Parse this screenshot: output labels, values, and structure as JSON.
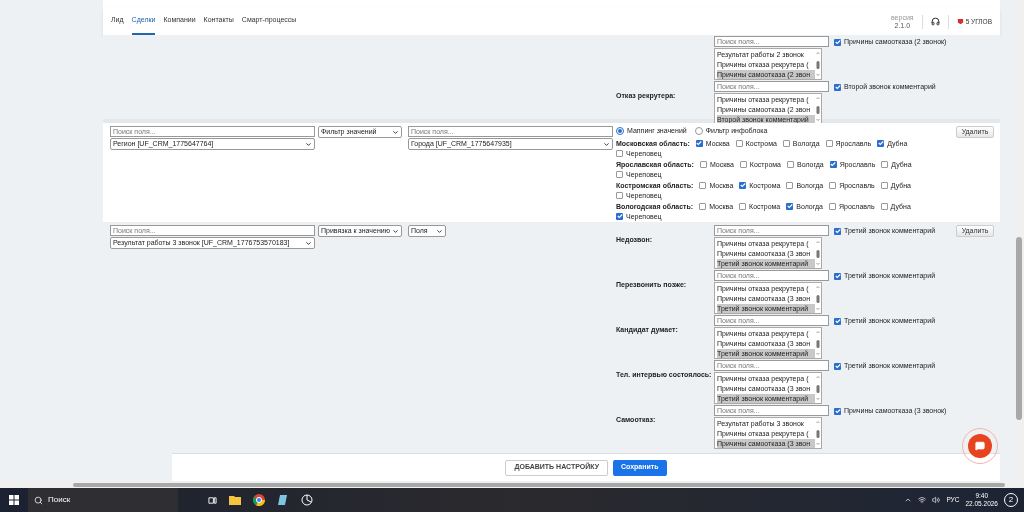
{
  "nav": {
    "tabs": [
      {
        "label": "Лид",
        "selected": false
      },
      {
        "label": "Сделки",
        "selected": true
      },
      {
        "label": "Компании",
        "selected": false
      },
      {
        "label": "Контакты",
        "selected": false
      },
      {
        "label": "Смарт-процессы",
        "selected": false
      }
    ],
    "version_label": "версия",
    "version": "2.1.0",
    "brand": "5 УГЛОВ"
  },
  "top_block": {
    "mappings": [
      {
        "search_placeholder": "Поиск поля...",
        "options": [
          {
            "label": "Результат работы 2 звонок",
            "selected": false
          },
          {
            "label": "Причины отказа рекрутера (",
            "selected": false
          },
          {
            "label": "Причины самоотказа (2 звон",
            "selected": true
          }
        ],
        "checked": true,
        "target": "Причины самоотказа (2 звонок)"
      },
      {
        "label": "Отказ рекрутера:",
        "search_placeholder": "Поиск поля...",
        "options": [
          {
            "label": "Причины отказа рекрутера (",
            "selected": false
          },
          {
            "label": "Причины самоотказа (2 звон",
            "selected": false
          },
          {
            "label": "Второй звонок комментарий",
            "selected": true
          }
        ],
        "checked": true,
        "target": "Второй звонок комментарий"
      }
    ]
  },
  "region_rule": {
    "source_placeholder": "Поиск поля...",
    "source_field": "Регион [UF_CRM_1775647764]",
    "mode": "Фильтр значений",
    "target_placeholder": "Поиск поля...",
    "target_field": "Города [UF_CRM_1775647935]",
    "radios": [
      {
        "label": "Маппинг значений",
        "selected": true
      },
      {
        "label": "Фильтр инфоблока",
        "selected": false
      }
    ],
    "regions": [
      {
        "label": "Московская область:",
        "options": [
          {
            "label": "Москва",
            "checked": true
          },
          {
            "label": "Кострома",
            "checked": false
          },
          {
            "label": "Вологда",
            "checked": false
          },
          {
            "label": "Ярославль",
            "checked": false
          },
          {
            "label": "Дубна",
            "checked": true
          },
          {
            "label": "Череповец",
            "checked": false
          }
        ]
      },
      {
        "label": "Ярославская область:",
        "options": [
          {
            "label": "Москва",
            "checked": false
          },
          {
            "label": "Кострома",
            "checked": false
          },
          {
            "label": "Вологда",
            "checked": false
          },
          {
            "label": "Ярославль",
            "checked": true
          },
          {
            "label": "Дубна",
            "checked": false
          },
          {
            "label": "Череповец",
            "checked": false
          }
        ]
      },
      {
        "label": "Костромская область:",
        "options": [
          {
            "label": "Москва",
            "checked": false
          },
          {
            "label": "Кострома",
            "checked": true
          },
          {
            "label": "Вологда",
            "checked": false
          },
          {
            "label": "Ярославль",
            "checked": false
          },
          {
            "label": "Дубна",
            "checked": false
          },
          {
            "label": "Череповец",
            "checked": false
          }
        ]
      },
      {
        "label": "Вологодская область:",
        "options": [
          {
            "label": "Москва",
            "checked": false
          },
          {
            "label": "Кострома",
            "checked": false
          },
          {
            "label": "Вологда",
            "checked": true
          },
          {
            "label": "Ярославль",
            "checked": false
          },
          {
            "label": "Дубна",
            "checked": false
          },
          {
            "label": "Череповец",
            "checked": true
          }
        ]
      }
    ],
    "delete": "Удалить"
  },
  "value_rule": {
    "source_placeholder": "Поиск поля...",
    "source_field": "Результат работы 3 звонок [UF_CRM_1776753570183]",
    "mode": "Привязка к значению",
    "target_field": "Поля",
    "delete": "Удалить",
    "mappings": [
      {
        "label": "Недозвон:",
        "search_placeholder": "Поиск поля...",
        "options": [
          {
            "label": "Причины отказа рекрутера (",
            "selected": false
          },
          {
            "label": "Причины самоотказа (3 звон",
            "selected": false
          },
          {
            "label": "Третий звонок комментарий",
            "selected": true
          }
        ],
        "checked": true,
        "target": "Третий звонок комментарий"
      },
      {
        "label": "Перезвонить позже:",
        "search_placeholder": "Поиск поля...",
        "options": [
          {
            "label": "Причины отказа рекрутера (",
            "selected": false
          },
          {
            "label": "Причины самоотказа (3 звон",
            "selected": false
          },
          {
            "label": "Третий звонок комментарий",
            "selected": true
          }
        ],
        "checked": true,
        "target": "Третий звонок комментарий"
      },
      {
        "label": "Кандидат думает:",
        "search_placeholder": "Поиск поля...",
        "options": [
          {
            "label": "Причины отказа рекрутера (",
            "selected": false
          },
          {
            "label": "Причины самоотказа (3 звон",
            "selected": false
          },
          {
            "label": "Третий звонок комментарий",
            "selected": true
          }
        ],
        "checked": true,
        "target": "Третий звонок комментарий"
      },
      {
        "label": "Тел. интервью состоялось:",
        "search_placeholder": "Поиск поля...",
        "options": [
          {
            "label": "Причины отказа рекрутера (",
            "selected": false
          },
          {
            "label": "Причины самоотказа (3 звон",
            "selected": false
          },
          {
            "label": "Третий звонок комментарий",
            "selected": true
          }
        ],
        "checked": true,
        "target": "Третий звонок комментарий"
      },
      {
        "label": "Самоотказ:",
        "search_placeholder": "Поиск поля...",
        "options": [
          {
            "label": "Результат работы 3 звонок",
            "selected": false
          },
          {
            "label": "Причины отказа рекрутера (",
            "selected": false
          },
          {
            "label": "Причины самоотказа (3 звон",
            "selected": true
          }
        ],
        "checked": true,
        "target": "Причины самоотказа (3 звонок)"
      }
    ]
  },
  "footer": {
    "add": "ДОБАВИТЬ НАСТРОЙКУ",
    "save": "Сохранить"
  },
  "taskbar": {
    "search": "Поиск",
    "language": "РУС",
    "time": "9:40",
    "date": "22.05.2026",
    "notifications": "2"
  }
}
